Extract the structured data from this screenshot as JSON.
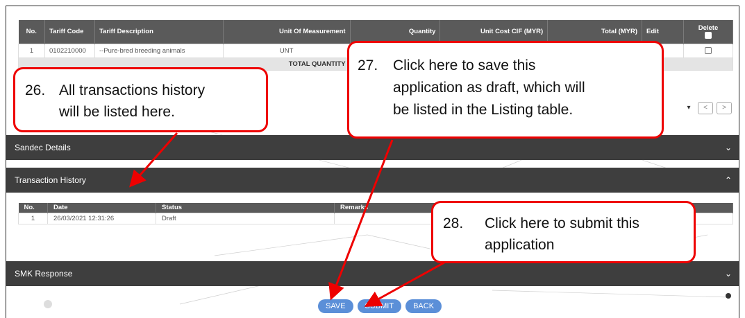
{
  "item_table": {
    "headers": {
      "no": "No.",
      "tariff_code": "Tariff Code",
      "tariff_desc": "Tariff Description",
      "uom": "Unit Of Measurement",
      "quantity": "Quantity",
      "unit_cost": "Unit Cost CIF (MYR)",
      "total": "Total (MYR)",
      "edit": "Edit",
      "delete": "Delete"
    },
    "rows": [
      {
        "no": "1",
        "tariff_code": "0102210000",
        "tariff_desc": "--Pure-bred breeding animals",
        "uom": "UNT"
      }
    ],
    "total_label": "TOTAL QUANTITY"
  },
  "pager": {
    "prev": "<",
    "next": ">",
    "dropdown": "▾"
  },
  "sections": {
    "sandec": {
      "title": "Sandec Details",
      "chevron": "⌄"
    },
    "history": {
      "title": "Transaction History",
      "chevron": "⌃"
    },
    "smk": {
      "title": "SMK Response",
      "chevron": "⌄"
    }
  },
  "history_table": {
    "headers": {
      "no": "No.",
      "date": "Date",
      "status": "Status",
      "remarks": "Remarks"
    },
    "rows": [
      {
        "no": "1",
        "date": "26/03/2021 12:31:26",
        "status": "Draft",
        "remarks": ""
      }
    ]
  },
  "buttons": {
    "save": "SAVE",
    "submit": "SUBMIT",
    "back": "BACK"
  },
  "callouts": {
    "c26": {
      "num": "26.",
      "line1": "All transactions history",
      "line2": "will be listed here."
    },
    "c27": {
      "num": "27.",
      "line1": "Click here to save this",
      "line2": "application as draft, which will",
      "line3": "be listed in the Listing table."
    },
    "c28": {
      "num": "28.",
      "line1": "Click here to submit this",
      "line2": "application"
    }
  },
  "colors": {
    "callout_border": "#e00000",
    "section_bar": "#3e3e3e",
    "button": "#5b8fd8",
    "table_header": "#5a5a5a"
  }
}
